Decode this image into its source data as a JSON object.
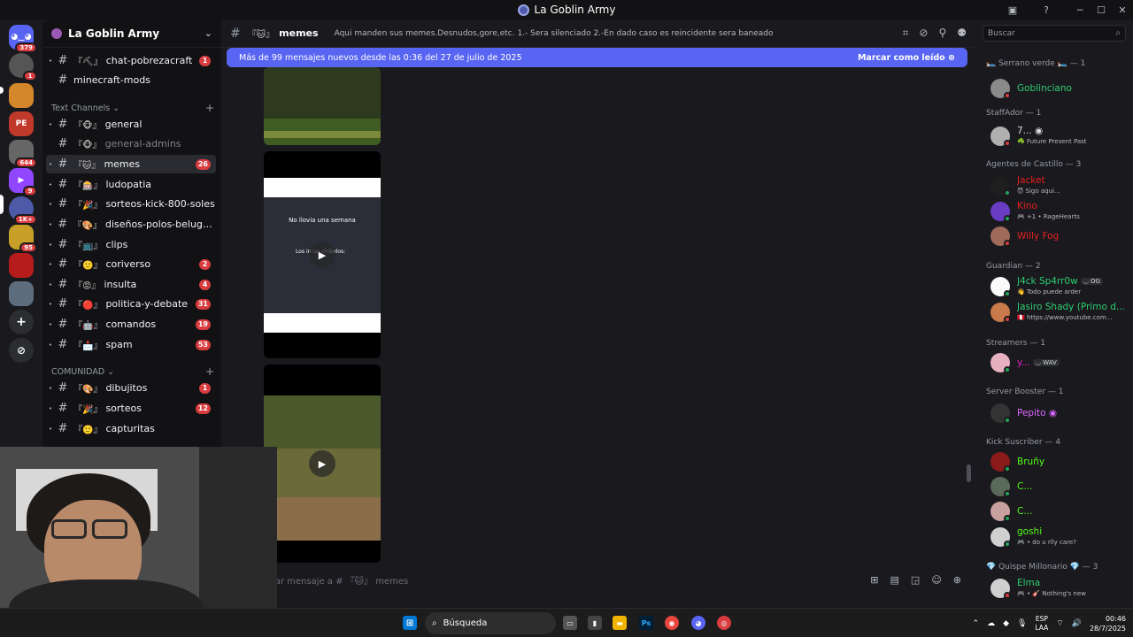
{
  "window": {
    "title": "La Goblin Army"
  },
  "rail": {
    "badges": [
      "379",
      "1",
      "644",
      "9",
      "1K+",
      "95"
    ]
  },
  "sidebar": {
    "server_name": "La Goblin Army",
    "top_channels": [
      {
        "emoji": "『⛏』",
        "name": "chat-pobrezacraft",
        "count": "1"
      },
      {
        "emoji": "",
        "name": "minecraft-mods",
        "count": ""
      }
    ],
    "cat_text": "Text Channels",
    "text_channels": [
      {
        "emoji": "『🐵』",
        "name": "general",
        "count": ""
      },
      {
        "emoji": "『🐵』",
        "name": "general-admins",
        "count": ""
      },
      {
        "emoji": "『🐱』",
        "name": "memes",
        "count": "26"
      },
      {
        "emoji": "『🎰』",
        "name": "ludopatia",
        "count": ""
      },
      {
        "emoji": "『🎉』",
        "name": "sorteos-kick-800-soles",
        "count": ""
      },
      {
        "emoji": "『🎨』",
        "name": "diseños-polos-beluga-ar...",
        "count": ""
      },
      {
        "emoji": "『📺』",
        "name": "clips",
        "count": ""
      },
      {
        "emoji": "『🙂』",
        "name": "coriverso",
        "count": "2"
      },
      {
        "emoji": "『😡』",
        "name": "insulta",
        "count": "4"
      },
      {
        "emoji": "『🔴』",
        "name": "politica-y-debate",
        "count": "31"
      },
      {
        "emoji": "『🤖』",
        "name": "comandos",
        "count": "19"
      },
      {
        "emoji": "『📩』",
        "name": "spam",
        "count": "53"
      }
    ],
    "cat_comunidad": "COMUNIDAD",
    "comunidad_channels": [
      {
        "emoji": "『🎨』",
        "name": "dibujitos",
        "count": "1"
      },
      {
        "emoji": "『🎉』",
        "name": "sorteos",
        "count": "12"
      },
      {
        "emoji": "『🙂』",
        "name": "capturitas",
        "count": ""
      }
    ]
  },
  "channel": {
    "emoji": "『🐱』",
    "name": "memes",
    "topic": "Aqui manden sus memes.Desnudos,gore,etc. 1.- Sera silenciado 2.-En dado caso es reincidente sera baneado"
  },
  "banner": {
    "text": "Más de 99 mensajes nuevos desde las 0:36 del 27 de julio de 2025",
    "mark": "Marcar como leído"
  },
  "video": {
    "line1": "No llovia una semana",
    "line2": "Los incas chibolos:"
  },
  "composer": {
    "placeholder": "viar mensaje a # 『🐱』 memes"
  },
  "search": {
    "placeholder": "Buscar"
  },
  "members": {
    "groups": [
      {
        "header": "🛏️ Serrano verde 🛏️ — 1",
        "items": [
          {
            "name": "Goblinciano",
            "sub": "",
            "color": "#2ecc71"
          }
        ]
      },
      {
        "header": "StaffAdor — 1",
        "items": [
          {
            "name": "7... ◉",
            "sub": "☘️ Future Present Past",
            "color": "#dbdee1"
          }
        ]
      },
      {
        "header": "Agentes de Castillo — 3",
        "items": [
          {
            "name": "Jacket",
            "sub": "😈 Sigo aqui...",
            "color": "#e91e1e"
          },
          {
            "name": "Kino",
            "sub": "🎮 +1 • RageHearts",
            "color": "#e91e1e"
          },
          {
            "name": "Willy Fog",
            "sub": "",
            "color": "#e91e1e"
          }
        ]
      },
      {
        "header": "Guardian — 2",
        "items": [
          {
            "name": "J4ck Sp4rr0w",
            "tag": "◡ OG",
            "sub": "👋 Todo puede arder",
            "color": "#2ecc71"
          },
          {
            "name": "Jasiro Shady (Primo d...",
            "sub": "🇵🇪 https://www.youtube.com...",
            "color": "#2ecc71"
          }
        ]
      },
      {
        "header": "Streamers — 1",
        "items": [
          {
            "name": "y...",
            "tag": "◡ WAV",
            "sub": "",
            "color": "#e91ec7"
          }
        ]
      },
      {
        "header": "Server Booster — 1",
        "items": [
          {
            "name": "Pepito ◉",
            "sub": "",
            "color": "#d966ff"
          }
        ]
      },
      {
        "header": "Kick Suscriber — 4",
        "items": [
          {
            "name": "Bruñy",
            "sub": "",
            "color": "#53fc18"
          },
          {
            "name": "C...",
            "sub": "",
            "color": "#53fc18"
          },
          {
            "name": "C...",
            "sub": "",
            "color": "#53fc18"
          },
          {
            "name": "goshi",
            "sub": "🎮 • do u rlly care?",
            "color": "#53fc18"
          }
        ]
      },
      {
        "header": "💎 Quispe Millonario 💎 — 3",
        "items": [
          {
            "name": "Elma",
            "sub": "🎮 • 🎸 Nothing's new",
            "color": "#2ecc71"
          }
        ]
      }
    ]
  },
  "taskbar": {
    "search": "Búsqueda",
    "lang1": "ESP",
    "lang2": "LAA",
    "time": "00:46",
    "date": "28/7/2025"
  }
}
